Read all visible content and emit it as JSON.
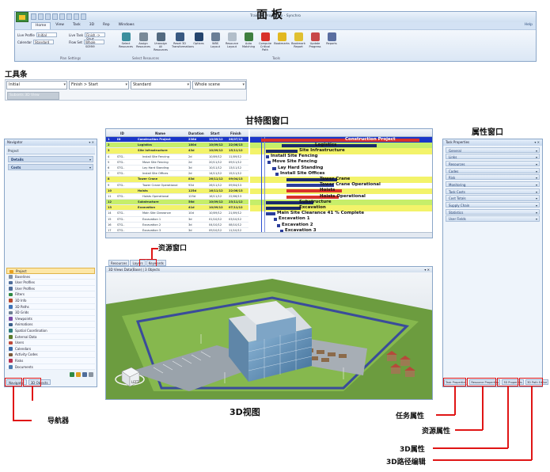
{
  "annotations": {
    "panel": "面  板",
    "toolbar": "工具条",
    "gantt": "甘特图窗口",
    "properties": "属性窗口",
    "resources": "资源窗口",
    "view3d": "3D视图",
    "navigator": "导航器",
    "task_props": "任务属性",
    "resource_props": "资源属性",
    "props_3d": "3D属性",
    "path_3d": "3D路径编辑"
  },
  "app": {
    "window_title": "Training Project.sp - Synchro",
    "menu_tabs": [
      "Home",
      "View",
      "Task",
      "3D",
      "Rep",
      "Windows"
    ],
    "help_label": "Help",
    "fields": [
      {
        "label": "Live Profile",
        "value": "Initial"
      },
      {
        "label": "Calendar",
        "value": "Standard"
      },
      {
        "label": "Live Task",
        "value": "Finish -> Start"
      },
      {
        "label": "Flow Set",
        "value": "Whole scene"
      }
    ],
    "group_labels": {
      "settings": "Plan Settings",
      "resources": "Select Resources",
      "tools": "Tools"
    },
    "buttons": [
      {
        "label": "Select Resources",
        "icon": "select-resources-icon",
        "color": "#3c8f9e"
      },
      {
        "label": "Assign Resources",
        "icon": "assign-resources-icon",
        "color": "#7a8a98"
      },
      {
        "label": "Unassign All Resources",
        "icon": "unassign-resources-icon",
        "color": "#556b80"
      },
      {
        "label": "Reset 3D Transformations",
        "icon": "reset-3d-icon",
        "color": "#3a5a82"
      },
      {
        "label": "Options",
        "icon": "options-icon",
        "color": "#25456e"
      },
      {
        "label": "WBS Layout",
        "icon": "wbs-layout-icon",
        "color": "#6a7e96"
      },
      {
        "label": "Resource Layout",
        "icon": "resource-layout-icon",
        "color": "#b2beca"
      },
      {
        "label": "Auto Matching",
        "icon": "auto-matching-icon",
        "color": "#3f7f3f"
      },
      {
        "label": "Compute Critical Path",
        "icon": "critical-path-icon",
        "color": "#d8322a"
      },
      {
        "label": "Bookmarks",
        "icon": "bookmarks-icon",
        "color": "#e2b820"
      },
      {
        "label": "Bookmark Report",
        "icon": "bookmark-report-icon",
        "color": "#e0c030"
      },
      {
        "label": "Update Progress",
        "icon": "update-progress-icon",
        "color": "#c84848"
      },
      {
        "label": "Reports",
        "icon": "reports-icon",
        "color": "#5a6ea0"
      }
    ]
  },
  "toolbar": {
    "combo_profile": "Initial",
    "combo_link": "Finish > Start",
    "combo_calendar": "Standard",
    "combo_scene": "Whole scene",
    "search": "Subsets 3D View"
  },
  "navigator": {
    "title": "Navigator",
    "project_label": "Project",
    "fields": [
      "Details",
      "Costs"
    ],
    "items": [
      {
        "label": "Project",
        "color": "#e8a020",
        "active": true
      },
      {
        "label": "Baselines",
        "color": "#7e8fa3"
      },
      {
        "label": "User Profiles",
        "color": "#4f6d9a"
      },
      {
        "label": "User Profiles",
        "color": "#4f6d9a"
      },
      {
        "label": "Filters",
        "color": "#2f8a45"
      },
      {
        "label": "3D Info",
        "color": "#b9482f"
      },
      {
        "label": "3D Paths",
        "color": "#3e73b7"
      },
      {
        "label": "3D Grids",
        "color": "#6d7f92"
      },
      {
        "label": "Viewpoints",
        "color": "#7a4aa8"
      },
      {
        "label": "Animations",
        "color": "#3b5f8a"
      },
      {
        "label": "Spatial Coordination",
        "color": "#2e7e7e"
      },
      {
        "label": "External Data",
        "color": "#5a7a2a"
      },
      {
        "label": "Users",
        "color": "#c04a3a"
      },
      {
        "label": "Calendars",
        "color": "#3a6aa8"
      },
      {
        "label": "Activity Codes",
        "color": "#7a5a3a"
      },
      {
        "label": "Risks",
        "color": "#b83050"
      },
      {
        "label": "Documents",
        "color": "#4a7ab0"
      }
    ],
    "tabs": [
      "Navigator",
      "3D Objects"
    ]
  },
  "gantt": {
    "headers": [
      "ID",
      "Name",
      "Duration",
      "Start",
      "Finish"
    ],
    "rows": [
      {
        "n": "1",
        "id": "ID",
        "name": "Construction Project",
        "dur": "236d",
        "start": "10/09/12",
        "finish": "26/07/13",
        "lv": 0
      },
      {
        "n": "2",
        "id": "",
        "name": "Logistics",
        "dur": "180d",
        "start": "10/09/12",
        "finish": "22/06/13",
        "lv": 1
      },
      {
        "n": "3",
        "id": "",
        "name": "Site Infrastructure",
        "dur": "43d",
        "start": "10/09/12",
        "finish": "15/11/12",
        "lv": 2
      },
      {
        "n": "4",
        "id": "STG..",
        "name": "Install Site Fencing",
        "dur": "2d",
        "start": "10/09/12",
        "finish": "11/09/12",
        "lv": 3
      },
      {
        "n": "5",
        "id": "STG..",
        "name": "Move Site Fencing",
        "dur": "2d",
        "start": "20/11/12",
        "finish": "09/11/12",
        "lv": 3
      },
      {
        "n": "6",
        "id": "STG..",
        "name": "Lay Hard Standing",
        "dur": "3d",
        "start": "10/11/12",
        "finish": "13/11/12",
        "lv": 3
      },
      {
        "n": "7",
        "id": "STG..",
        "name": "Install Site Offices",
        "dur": "2d",
        "start": "14/11/12",
        "finish": "15/11/12",
        "lv": 3
      },
      {
        "n": "8",
        "id": "",
        "name": "Tower Crane",
        "dur": "83d",
        "start": "26/11/12",
        "finish": "09/04/13",
        "lv": 2
      },
      {
        "n": "9",
        "id": "STG..",
        "name": "Tower Crane Operational",
        "dur": "93d",
        "start": "26/11/12",
        "finish": "09/04/13",
        "lv": 3
      },
      {
        "n": "10",
        "id": "",
        "name": "Hoists",
        "dur": "125d",
        "start": "16/11/12",
        "finish": "22/06/13",
        "lv": 2
      },
      {
        "n": "11",
        "id": "STG..",
        "name": "Hoists Operational",
        "dur": "125d",
        "start": "16/11/12",
        "finish": "22/06/13",
        "lv": 3
      },
      {
        "n": "12",
        "id": "",
        "name": "Substructure",
        "dur": "56d",
        "start": "10/09/12",
        "finish": "23/11/12",
        "lv": 1
      },
      {
        "n": "13",
        "id": "",
        "name": "Excavation",
        "dur": "41d",
        "start": "10/09/12",
        "finish": "07/11/12",
        "lv": 2
      },
      {
        "n": "14",
        "id": "STG..",
        "name": "Main Site Clearance",
        "dur": "10d",
        "start": "10/09/12",
        "finish": "21/09/12",
        "lv": 3
      },
      {
        "n": "15",
        "id": "STG..",
        "name": "Excavation 1",
        "dur": "3d",
        "start": "01/10/12",
        "finish": "03/10/12",
        "lv": 3
      },
      {
        "n": "16",
        "id": "STG..",
        "name": "Excavation 2",
        "dur": "3d",
        "start": "04/10/12",
        "finish": "08/10/12",
        "lv": 3
      },
      {
        "n": "17",
        "id": "STG..",
        "name": "Excavation 3",
        "dur": "3d",
        "start": "09/10/12",
        "finish": "11/10/12",
        "lv": 3
      },
      {
        "n": "18",
        "id": "",
        "name": "",
        "dur": "",
        "start": "",
        "finish": "",
        "lv": 2
      }
    ],
    "chart_labels": [
      "Construction Project",
      "Logistics",
      "Site Infrastructure",
      "Install Site Fencing",
      "Move Site Fencing",
      "Lay Hard Standing",
      "Install Site Offices",
      "Tower Crane",
      "Tower Crane Operational",
      "Hoists",
      "Hoists Operational",
      "Substructure",
      "Excavation",
      "Main Site Clearance  41 % Complete",
      "Excavation 1",
      "Excavation 2",
      "Excavation 3"
    ]
  },
  "resource_tabs": [
    "Resources",
    "Layers",
    "Keywords"
  ],
  "view3d": {
    "title": "3D Views Data(Base) | 3 Objects",
    "cube_label": "LEFT"
  },
  "properties": {
    "title": "Task Properties",
    "items": [
      "General",
      "Links",
      "Resources",
      "Codes",
      "Risk",
      "Monitoring",
      "Task Costs",
      "Cost Totals",
      "Supply Chain",
      "Statistics",
      "User Fields"
    ],
    "tabs": [
      "Task Properties",
      "Resource Properties",
      "3D Properties",
      "3D Path Editor"
    ]
  }
}
